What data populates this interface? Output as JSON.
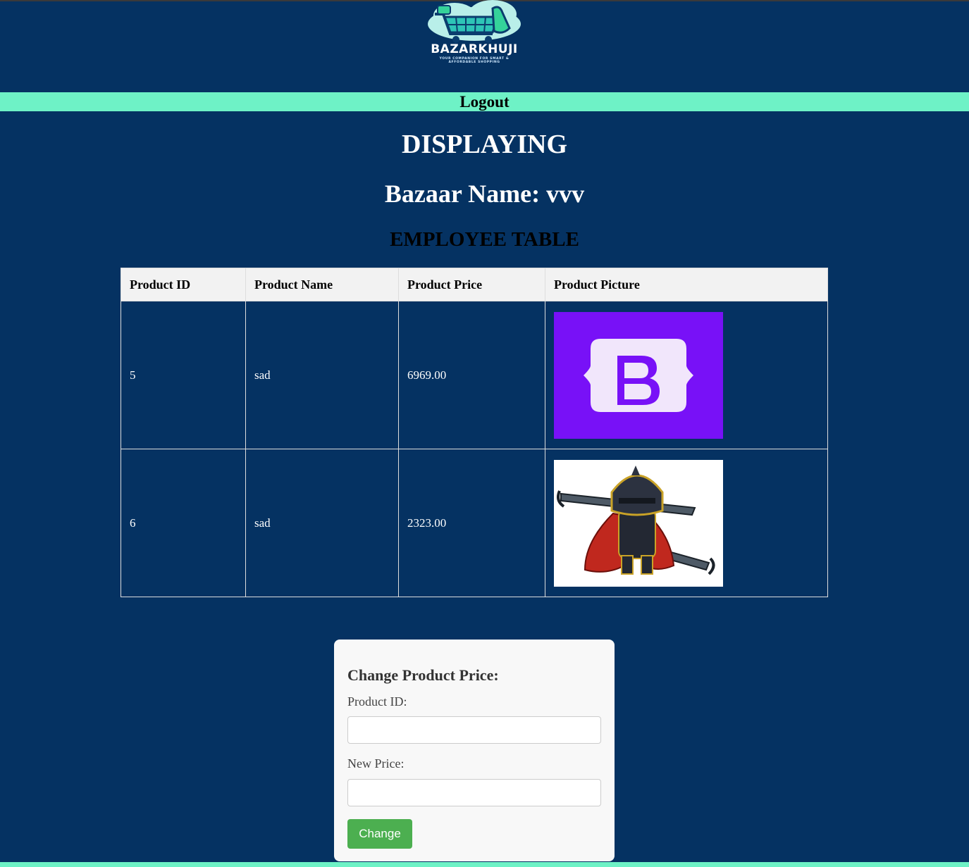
{
  "brand": {
    "name": "BAZARKHUJI",
    "tagline_line1": "YOUR COMPANION FOR SMART &",
    "tagline_line2": "AFFORDABLE SHOPPING"
  },
  "nav": {
    "logout_label": "Logout"
  },
  "headings": {
    "displaying": "DISPLAYING",
    "bazaar_name": "Bazaar Name: vvv",
    "table_title": "EMPLOYEE TABLE"
  },
  "table": {
    "columns": [
      "Product ID",
      "Product Name",
      "Product Price",
      "Product Picture"
    ],
    "rows": [
      {
        "id": "5",
        "name": "sad",
        "price": "6969.00",
        "picture": "bootstrap-logo-image"
      },
      {
        "id": "6",
        "name": "sad",
        "price": "2323.00",
        "picture": "armored-knight-character-image"
      }
    ]
  },
  "form": {
    "title": "Change Product Price:",
    "product_id_label": "Product ID:",
    "product_id_value": "",
    "new_price_label": "New Price:",
    "new_price_value": "",
    "submit_label": "Change"
  },
  "colors": {
    "background": "#053262",
    "accent": "#6ef2c6",
    "button": "#4caf50",
    "bootstrap_purple": "#7811f7"
  }
}
